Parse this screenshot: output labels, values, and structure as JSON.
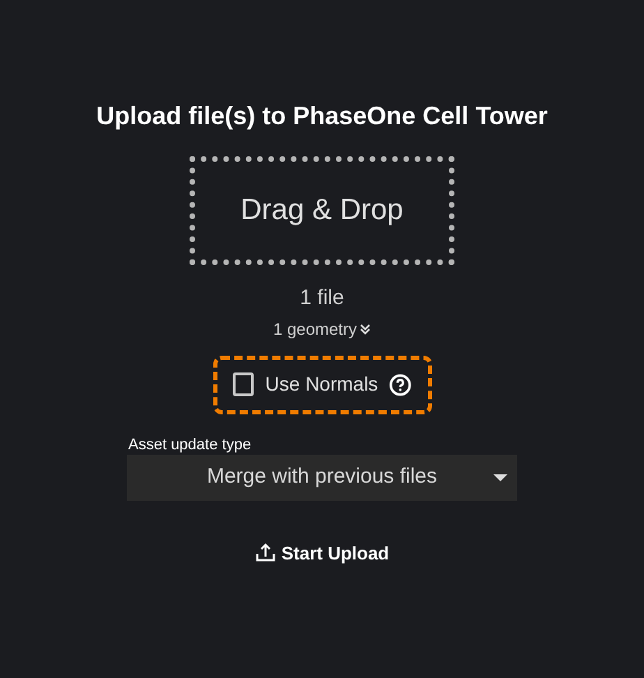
{
  "title": "Upload file(s) to PhaseOne Cell Tower",
  "drop_zone": {
    "label": "Drag & Drop"
  },
  "file_count": "1 file",
  "geometry_toggle": {
    "label": "1 geometry",
    "expanded": false
  },
  "use_normals": {
    "label": "Use Normals",
    "checked": false,
    "focused": true
  },
  "asset_update_type": {
    "label": "Asset update type",
    "value": "Merge with previous files"
  },
  "start_button": {
    "label": "Start Upload"
  }
}
